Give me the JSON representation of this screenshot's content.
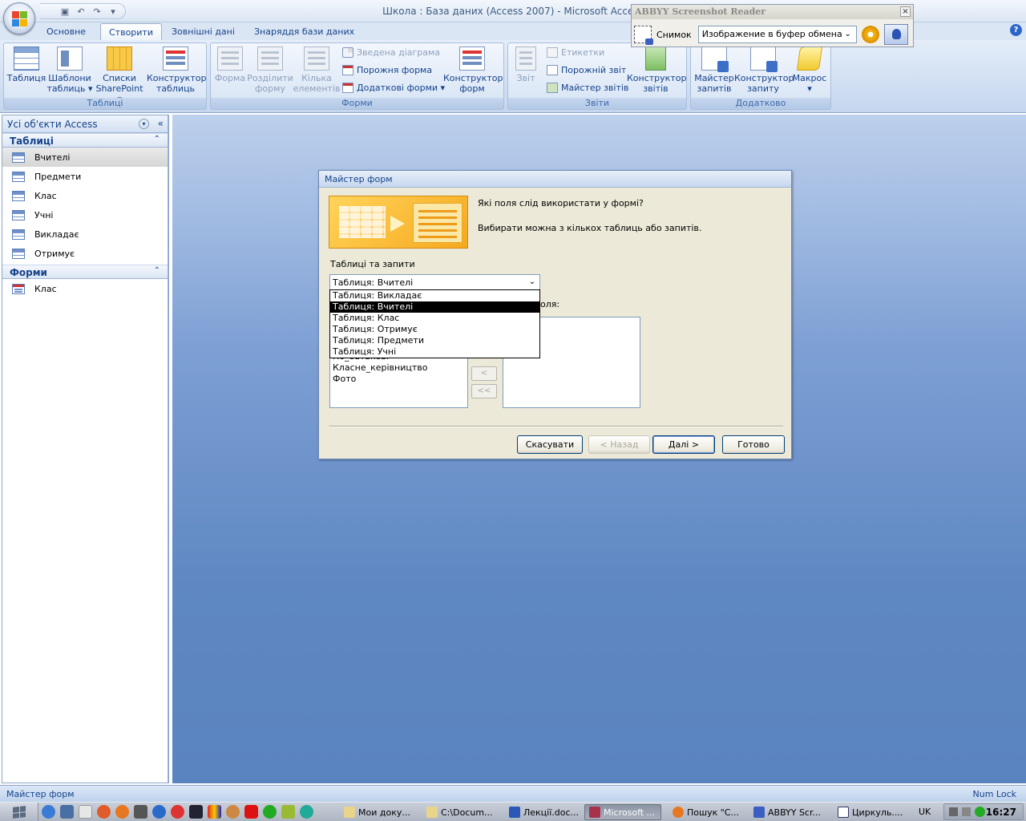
{
  "window": {
    "title": "Школа : База даних (Access 2007) - Microsoft Access"
  },
  "qat": {
    "save_icon": "save-icon",
    "undo_icon": "undo-icon",
    "redo_icon": "redo-icon",
    "more": "▾"
  },
  "abbyy": {
    "title": "ABBYY Screenshot Reader",
    "snapshot_label": "Снимок",
    "target_value": "Изображение в буфер обмена",
    "close": "×"
  },
  "tabs": [
    "Основне",
    "Створити",
    "Зовнішні дані",
    "Знаряддя бази даних"
  ],
  "active_tab": "Створити",
  "help": "?",
  "ribbon": {
    "tables": {
      "label": "Таблиці",
      "table": "Таблиця",
      "templates_1": "Шаблони",
      "templates_2": "таблиць ▾",
      "sharepoint_1": "Списки",
      "sharepoint_2": "SharePoint ▾",
      "designer_1": "Конструктор",
      "designer_2": "таблиць"
    },
    "forms": {
      "label": "Форми",
      "form": "Форма",
      "split_1": "Розділити",
      "split_2": "форму",
      "multiple_1": "Кілька",
      "multiple_2": "елементів",
      "pivot_chart": "Зведена діаграма",
      "blank_form": "Порожня форма",
      "more_forms": "Додаткові форми ▾",
      "designer_1": "Конструктор",
      "designer_2": "форм"
    },
    "reports": {
      "label": "Звіти",
      "report": "Звіт",
      "labels": "Етикетки",
      "blank_report": "Порожній звіт",
      "report_wizard": "Майстер звітів",
      "designer_1": "Конструктор",
      "designer_2": "звітів"
    },
    "other": {
      "label": "Додатково",
      "query_wizard_1": "Майстер",
      "query_wizard_2": "запитів",
      "query_designer_1": "Конструктор",
      "query_designer_2": "запиту",
      "macro": "Макрос",
      "macro_more": "▾"
    }
  },
  "nav": {
    "header": "Усі об'єкти Access",
    "dropdown": "▾",
    "collapse": "«",
    "groups": [
      {
        "title": "Таблиці",
        "chevron": "⌃",
        "items": [
          "Вчителі",
          "Предмети",
          "Клас",
          "Учні",
          "Викладає",
          "Отримує"
        ]
      },
      {
        "title": "Форми",
        "chevron": "⌃",
        "items": [
          "Клас"
        ]
      }
    ],
    "selected": "Вчителі"
  },
  "dialog": {
    "title": "Майстер форм",
    "question": "Які поля слід використати у формі?",
    "hint": "Вибирати можна з кількох таблиць або запитів.",
    "tables_label": "Таблиці та запити",
    "combo_value": "Таблиця: Вчителі",
    "combo_arrow": "⌄",
    "dropdown_options": [
      "Таблиця: Викладає",
      "Таблиця: Вчителі",
      "Таблиця: Клас",
      "Таблиця: Отримує",
      "Таблиця: Предмети",
      "Таблиця: Учні"
    ],
    "dropdown_selected_index": 1,
    "selected_fields_label": "оля:",
    "available_fields_visible": [
      "По_батькові",
      "Класне_керівництво",
      "Фото"
    ],
    "move_left": "<",
    "move_all_left": "<<",
    "buttons": {
      "cancel": "Скасувати",
      "back": "< Назад",
      "next": "Далі >",
      "finish": "Готово"
    }
  },
  "status": {
    "left": "Майстер форм",
    "right": "Num Lock"
  },
  "taskbar": {
    "tasks": [
      "Мои доку...",
      "C:\\Docum...",
      "Лекції.doc...",
      "Microsoft ...",
      "Пошук \"C...",
      "ABBYY Scr...",
      "Циркуль...."
    ],
    "active_task": "Microsoft ...",
    "language": "UK",
    "clock": "16:27"
  },
  "colors": {
    "accent": "#15428b",
    "workspace_top": "#bdd0ec",
    "workspace_bottom": "#5a84bf",
    "dialog_bg": "#ece9d8"
  }
}
